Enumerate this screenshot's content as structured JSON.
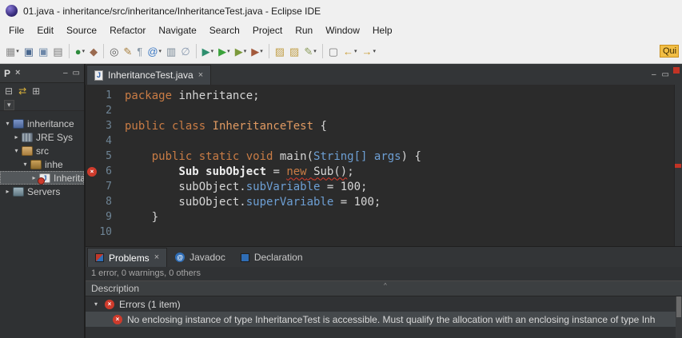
{
  "window": {
    "title": "01.java - inheritance/src/inheritance/InheritanceTest.java - Eclipse IDE"
  },
  "icons": {
    "close": "×",
    "min": "–",
    "max": "▭",
    "caret": "▾",
    "expanded": "▾",
    "collapsed": "▸",
    "sort": "^"
  },
  "menubar": [
    "File",
    "Edit",
    "Source",
    "Refactor",
    "Navigate",
    "Search",
    "Project",
    "Run",
    "Window",
    "Help"
  ],
  "toolbar": {
    "quick_access": "Qui",
    "items": [
      {
        "n": "new-wizard-icon",
        "g": "▦",
        "c": "#8a8a8a",
        "cr": true
      },
      {
        "n": "save-icon",
        "g": "▣",
        "c": "#49678F"
      },
      {
        "n": "save-all-icon",
        "g": "▣",
        "c": "#6C87A8"
      },
      {
        "n": "print-icon",
        "g": "▤",
        "c": "#7a7a7a"
      },
      {
        "sep": true
      },
      {
        "n": "coverage-icon",
        "g": "●",
        "c": "#2E8B3D",
        "cr": true
      },
      {
        "n": "build-all-icon",
        "g": "◆",
        "c": "#9A6A4F"
      },
      {
        "sep": true
      },
      {
        "n": "search-icon",
        "g": "◎",
        "c": "#5a5a5a"
      },
      {
        "n": "edit-pencil-icon",
        "g": "✎",
        "c": "#A8803F"
      },
      {
        "n": "show-whitespace-icon",
        "g": "¶",
        "c": "#8a9aa8"
      },
      {
        "n": "annotations-icon",
        "g": "@",
        "c": "#3B78C4",
        "cr": true
      },
      {
        "n": "mark-occurrences-icon",
        "g": "▥",
        "c": "#7a8a98"
      },
      {
        "n": "skip-breakpoints-icon",
        "g": "∅",
        "c": "#8a9ab0"
      },
      {
        "sep": true
      },
      {
        "n": "debug-icon",
        "g": "▶",
        "c": "#2F8F6F",
        "cr": true
      },
      {
        "n": "run-icon",
        "g": "▶",
        "c": "#3BA23B",
        "cr": true
      },
      {
        "n": "external-tools-icon",
        "g": "▶",
        "c": "#7C9A3C",
        "cr": true
      },
      {
        "n": "profile-icon",
        "g": "▶",
        "c": "#A35A3C",
        "cr": true
      },
      {
        "sep": true
      },
      {
        "n": "open-type-icon",
        "g": "▨",
        "c": "#C2A04A"
      },
      {
        "n": "open-resource-icon",
        "g": "▨",
        "c": "#C2A04A"
      },
      {
        "n": "task-edit-icon",
        "g": "✎",
        "c": "#8A9A5A",
        "cr": true
      },
      {
        "sep": true
      },
      {
        "n": "new-window-icon",
        "g": "▢",
        "c": "#7a7a7a"
      },
      {
        "n": "back-arrow-icon",
        "g": "←",
        "c": "#C99A2E",
        "cr": true
      },
      {
        "n": "forward-arrow-icon",
        "g": "→",
        "c": "#C99A2E",
        "cr": true
      }
    ]
  },
  "explorer": {
    "title": "P",
    "toolbar": [
      {
        "n": "collapse-all-icon",
        "g": "⊟",
        "c": "#B8B8B8"
      },
      {
        "n": "link-with-editor-icon",
        "g": "⇄",
        "c": "#D9B13B"
      },
      {
        "n": "focus-active-task-icon",
        "g": "⊞",
        "c": "#B8B8B8"
      }
    ],
    "tree": [
      {
        "label": "inheritance",
        "icon": "java-project",
        "arrow": "expanded",
        "level": 0
      },
      {
        "label": "JRE Sys",
        "icon": "jre-library",
        "arrow": "collapsed",
        "level": 1
      },
      {
        "label": "src",
        "icon": "source-folder",
        "arrow": "expanded",
        "level": 1
      },
      {
        "label": "inhe",
        "icon": "package",
        "arrow": "expanded",
        "level": 2
      },
      {
        "label": "InheritanceTest.java",
        "icon": "java-file",
        "glyph": "J",
        "arrow": "collapsed",
        "level": 3,
        "selected": true,
        "error": true
      },
      {
        "label": "Servers",
        "icon": "servers",
        "arrow": "collapsed",
        "level": 0
      }
    ]
  },
  "editor": {
    "tab": {
      "label": "InheritanceTest.java",
      "glyph": "J"
    },
    "code": {
      "lines": [
        {
          "n": 1,
          "segs": [
            [
              "package",
              "k"
            ],
            [
              " inheritance;",
              "p"
            ]
          ]
        },
        {
          "n": 2,
          "segs": []
        },
        {
          "n": 3,
          "segs": [
            [
              "public class ",
              "k"
            ],
            [
              "InheritanceTest",
              "c"
            ],
            [
              " {",
              "p"
            ]
          ]
        },
        {
          "n": 4,
          "segs": []
        },
        {
          "n": 5,
          "segs": [
            [
              "    ",
              "p"
            ],
            [
              "public static void ",
              "k"
            ],
            [
              "main",
              "p"
            ],
            [
              "(",
              "p"
            ],
            [
              "String[] args",
              "t"
            ],
            [
              ") {",
              "p"
            ]
          ]
        },
        {
          "n": 6,
          "err": true,
          "segs": [
            [
              "        ",
              "p"
            ],
            [
              "Sub",
              "b"
            ],
            [
              " ",
              "p"
            ],
            [
              "subObject",
              "b"
            ],
            [
              " = ",
              "p"
            ],
            [
              "new",
              "ke"
            ],
            [
              " ",
              "pe"
            ],
            [
              "Sub()",
              "pe"
            ],
            [
              ";",
              "p"
            ]
          ]
        },
        {
          "n": 7,
          "segs": [
            [
              "        subObject.",
              "p"
            ],
            [
              "subVariable",
              "t"
            ],
            [
              " = 100;",
              "p"
            ]
          ]
        },
        {
          "n": 8,
          "segs": [
            [
              "        subObject.",
              "p"
            ],
            [
              "superVariable",
              "t"
            ],
            [
              " = 100;",
              "p"
            ]
          ]
        },
        {
          "n": 9,
          "segs": [
            [
              "    }",
              "p"
            ]
          ]
        },
        {
          "n": 10,
          "segs": []
        }
      ]
    }
  },
  "problems": {
    "tabs": [
      {
        "label": "Problems",
        "icon": "problems-icon",
        "active": true,
        "closable": true
      },
      {
        "label": "Javadoc",
        "icon": "javadoc-icon",
        "glyph": "@"
      },
      {
        "label": "Declaration",
        "icon": "declaration-icon"
      }
    ],
    "summary": "1 error, 0 warnings, 0 others",
    "header": "Description",
    "groups": [
      {
        "label": "Errors (1 item)",
        "expanded": true,
        "children": [
          {
            "text": "No enclosing instance of type InheritanceTest is accessible. Must qualify the allocation with an enclosing instance of type Inh"
          }
        ]
      }
    ]
  }
}
